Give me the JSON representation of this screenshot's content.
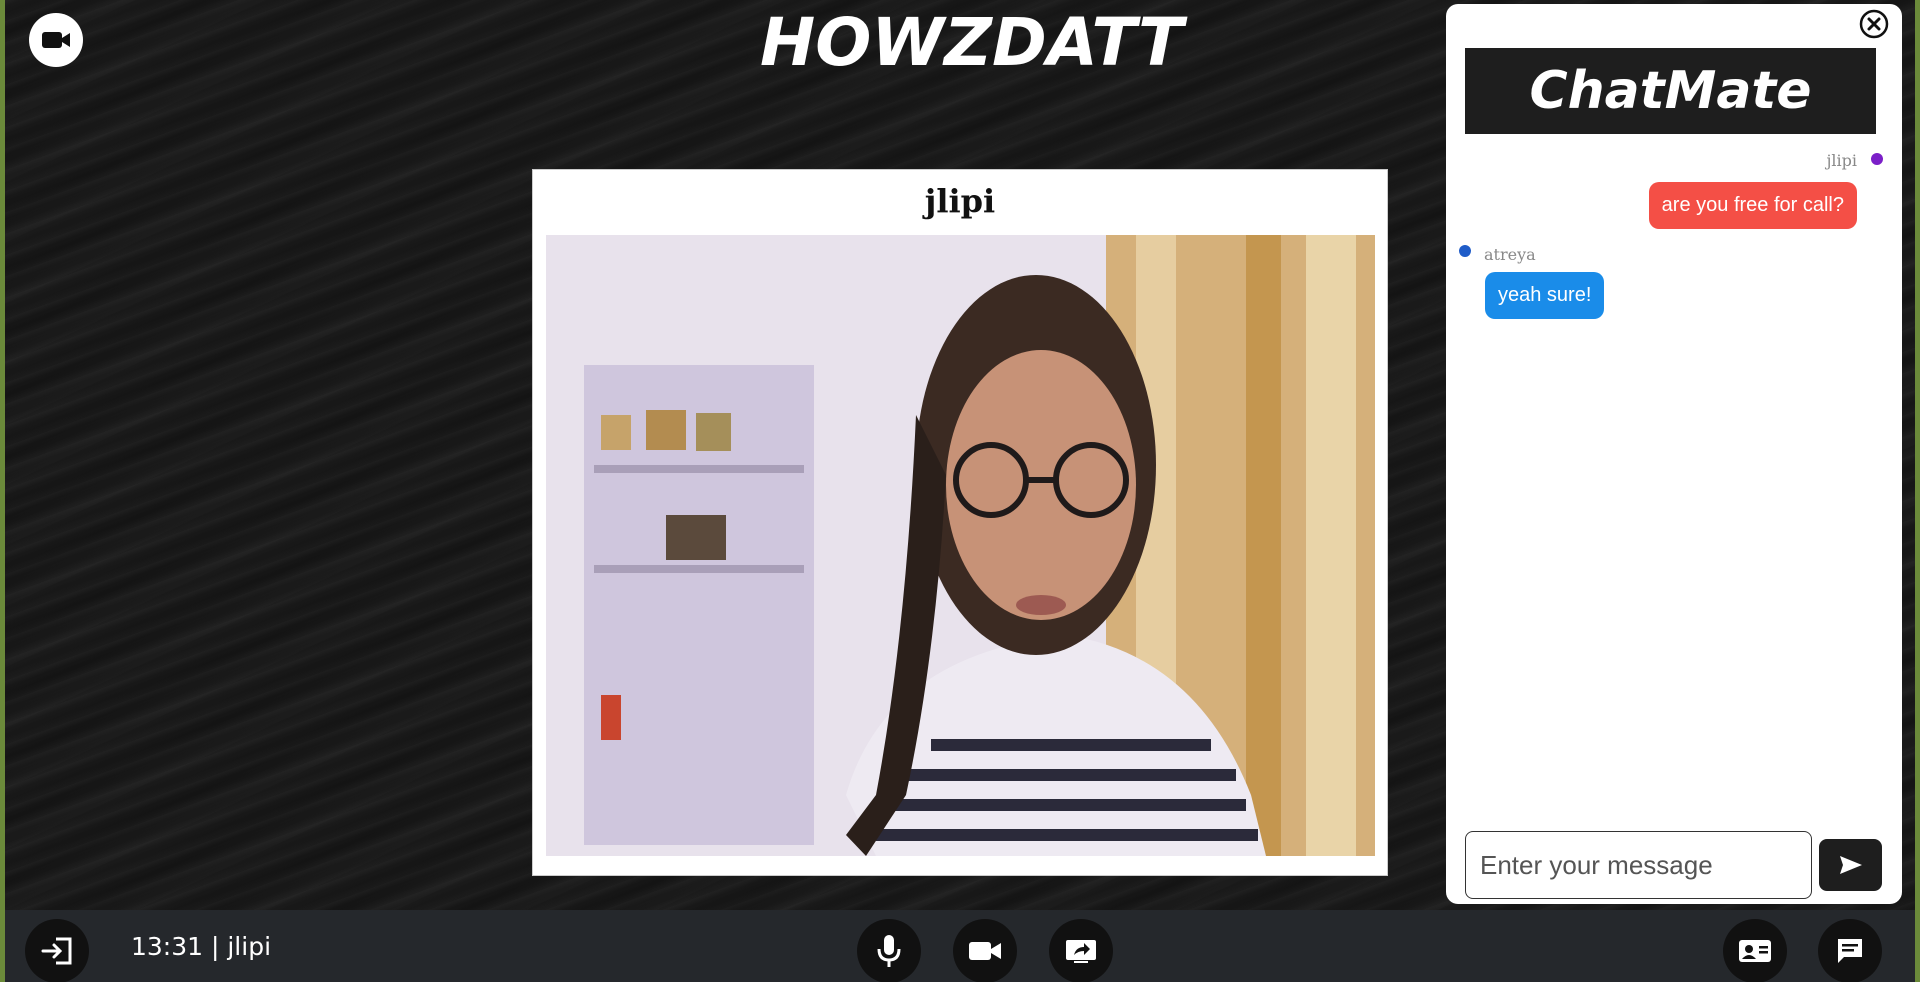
{
  "app": {
    "title": "HOWZDATT"
  },
  "video": {
    "participant_name": "jlipi"
  },
  "chat": {
    "title": "ChatMate",
    "messages": [
      {
        "sender": "jlipi",
        "text": "are you free for call?",
        "side": "right",
        "bubble_color": "#f44f46",
        "dot_color": "#7b1fc8"
      },
      {
        "sender": "atreya",
        "text": "yeah sure!",
        "side": "left",
        "bubble_color": "#1a8ce9",
        "dot_color": "#1f5cc8"
      }
    ],
    "input": {
      "placeholder": "Enter your message",
      "value": ""
    }
  },
  "status": {
    "text": "13:31 | jlipi"
  },
  "controls": {
    "icons": [
      "exit-icon",
      "microphone-icon",
      "camera-icon",
      "screen-share-icon",
      "participants-icon",
      "chat-icon"
    ]
  },
  "colors": {
    "bar": "#25282c",
    "button": "#111111",
    "panel_header": "#1e1e1e",
    "frame": "#6b8a3a"
  }
}
